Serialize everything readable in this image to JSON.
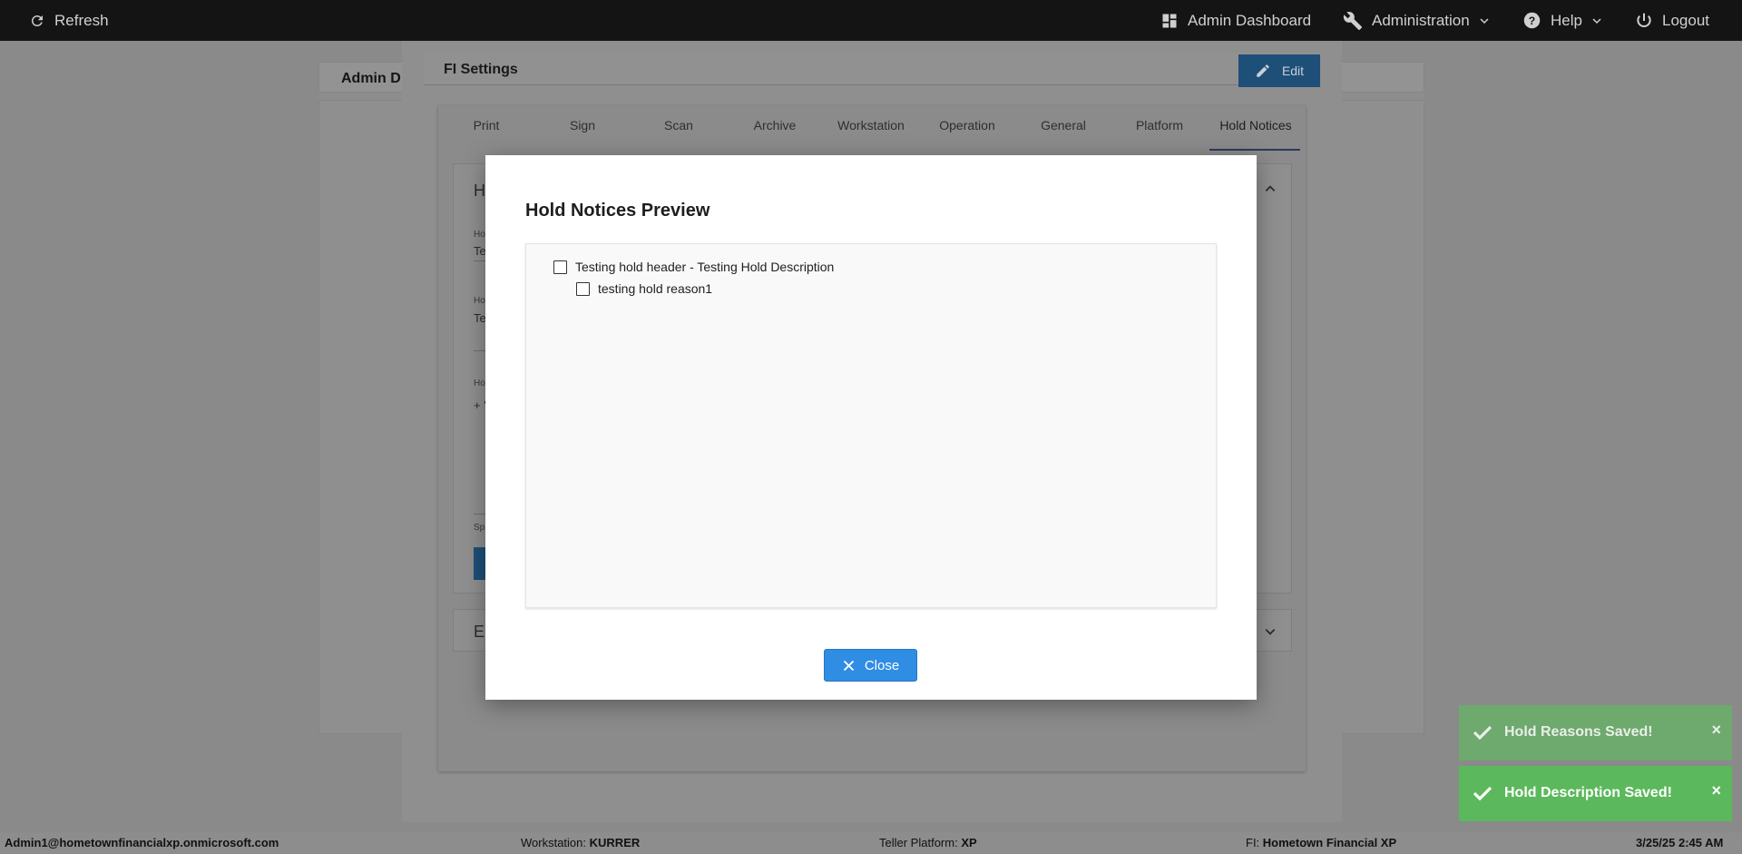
{
  "topbar": {
    "refresh": "Refresh",
    "admin_dashboard": "Admin Dashboard",
    "administration": "Administration",
    "help": "Help",
    "logout": "Logout"
  },
  "background_page": {
    "header_partial": "Admin D"
  },
  "fi_settings": {
    "title": "FI Settings",
    "edit_label": "Edit",
    "tabs": [
      "Print",
      "Sign",
      "Scan",
      "Archive",
      "Workstation",
      "Operation",
      "General",
      "Platform",
      "Hold Notices"
    ],
    "active_tab": "Hold Notices",
    "section1_partial": "H",
    "field_label_partial_1": "Ho",
    "field_value_partial_1": "Te",
    "field_label_partial_2": "Ho",
    "field_value_partial_2": "Te",
    "field_label_partial_3": "Ho",
    "field_value_partial_3": "+ '",
    "field_label_partial_4": "Sp",
    "section2_partial": "E"
  },
  "preview_dialog": {
    "title": "Hold Notices Preview",
    "items": [
      {
        "label": "Testing hold header - Testing Hold Description",
        "level": 0
      },
      {
        "label": "testing hold reason1",
        "level": 1
      }
    ],
    "close_label": "Close"
  },
  "toasts": [
    {
      "message": "Hold Reasons Saved!",
      "color": "#6ea96e"
    },
    {
      "message": "Hold Description Saved!",
      "color": "#5cb85c"
    }
  ],
  "statusbar": {
    "user": "Admin1@hometownfinancialxp.onmicrosoft.com",
    "workstation_label": "Workstation:",
    "workstation_value": "KURRER",
    "platform_label": "Teller Platform:",
    "platform_value": "XP",
    "fi_label": "FI:",
    "fi_value": "Hometown Financial XP",
    "datetime": "3/25/25 2:45 AM"
  },
  "colors": {
    "primary_button": "#2f8de4",
    "success_toast": "#5cb85c",
    "topbar": "#141414"
  }
}
